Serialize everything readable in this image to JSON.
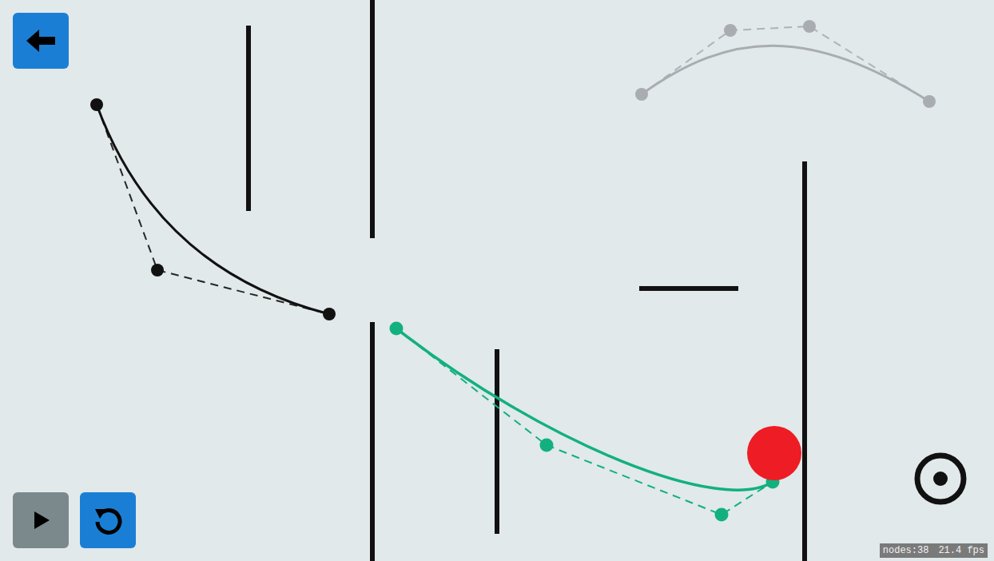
{
  "controls": [
    {
      "kind": "back",
      "disabled": false
    },
    {
      "kind": "play",
      "disabled": true
    },
    {
      "kind": "reset",
      "disabled": false
    }
  ],
  "curves": [
    {
      "color": "#111111",
      "selected": false
    },
    {
      "color": "#13b07f",
      "selected": true
    },
    {
      "color": "#a9adb1",
      "selected": false
    }
  ],
  "ball": {
    "color": "#ee1c24"
  },
  "status": {
    "nodes": "nodes:38",
    "fps": "21.4 fps"
  }
}
